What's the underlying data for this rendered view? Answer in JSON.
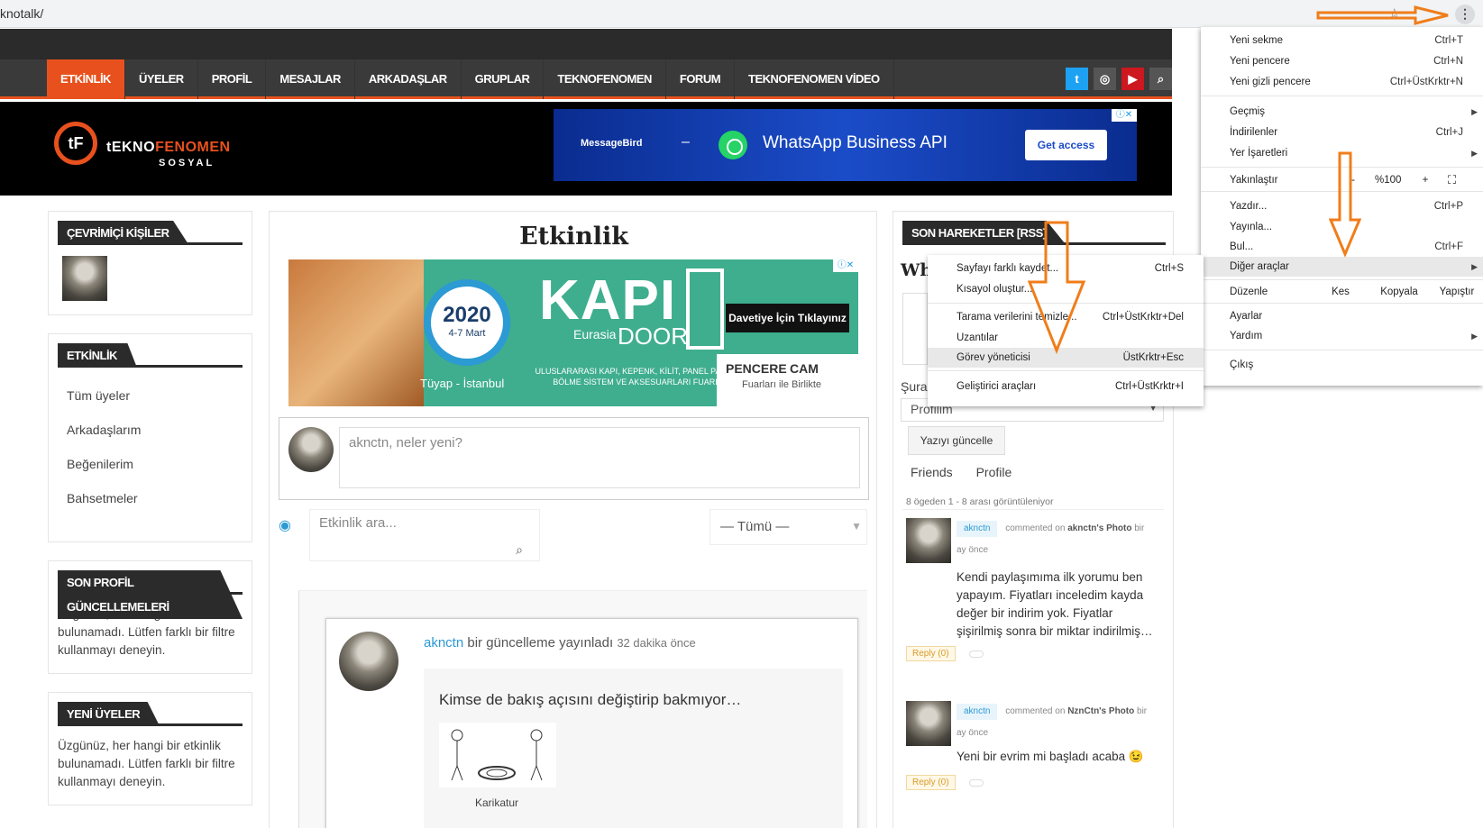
{
  "browser": {
    "url": "knotalk/",
    "star_icon": "star-icon",
    "menu_icon": "kebab-menu-icon"
  },
  "nav": {
    "items": [
      "ETKİNLİK",
      "ÜYELER",
      "PROFİL",
      "MESAJLAR",
      "ARKADAŞLAR",
      "GRUPLAR",
      "TEKNOFENOMEN",
      "FORUM",
      "TEKNOFENOMEN VİDEO"
    ],
    "active_index": 0,
    "social": [
      "twitter-icon",
      "instagram-icon",
      "youtube-icon",
      "search-icon"
    ],
    "accent": "#e8511d"
  },
  "logo": {
    "mark": "tF",
    "name_a": "tEKNO",
    "name_b": "FENOMEN",
    "sub": "SOSYAL"
  },
  "ad_top": {
    "brand": "MessageBird",
    "dash": "–",
    "title": "WhatsApp Business API",
    "button": "Get access"
  },
  "left": {
    "online": {
      "title": "ÇEVRİMİÇİ KİŞİLER"
    },
    "activity": {
      "title": "ETKİNLİK",
      "links": [
        "Tüm üyeler",
        "Arkadaşlarım",
        "Beğenilerim",
        "Bahsetmeler"
      ]
    },
    "profile_updates": {
      "title": "SON PROFİL GÜNCELLEMELERİ",
      "text": "Üzgünüz, her hangi bir etkinlik bulunamadı. Lütfen farklı bir filtre kullanmayı deneyin."
    },
    "new_members": {
      "title": "YENİ ÜYELER",
      "text": "Üzgünüz, her hangi bir etkinlik bulunamadı. Lütfen farklı bir filtre kullanmayı deneyin."
    }
  },
  "main": {
    "title": "Etkinlik",
    "ad": {
      "year": "2020",
      "dates": "4-7 Mart",
      "venue": "Tüyap - İstanbul",
      "kapi": "KAPI",
      "eurasia": "Eurasia",
      "door": "DOOR",
      "desc": "ULUSLARARASI KAPI, KEPENK, KİLİT, PANEL PANO, BÖLME SİSTEM VE AKSESUARLARI FUARI",
      "cta": "Davetiye İçin Tıklayınız",
      "pencere": "PENCERE",
      "cam": "CAM",
      "together": "Fuarları ile Birlikte"
    },
    "post_placeholder": "aknctn, neler yeni?",
    "search_placeholder": "Etkinlik ara...",
    "filter_value": "— Tümü —",
    "activity": {
      "user": "aknctn",
      "action": "bir güncelleme yayınladı",
      "time": "32 dakika önce",
      "text": "Kimse de bakış açısını değiştirip bakmıyor…",
      "caption": "Karikatur"
    }
  },
  "right": {
    "title": "SON HAREKETLER [RSS]",
    "wh": "Wh",
    "sura": "Şura",
    "select_value": "Profilim",
    "update_button": "Yazıyı güncelle",
    "tabs": [
      "Friends",
      "Profile"
    ],
    "count": "8 ögeden 1 - 8 arası görüntüleniyor",
    "comments": [
      {
        "user": "aknctn",
        "action": "commented on",
        "target": "aknctn's Photo",
        "time_a": "bir",
        "time_b": "ay önce",
        "body": "Kendi paylaşımıma ilk yorumu ben yapayım. Fiyatları inceledim kayda değer bir indirim yok. Fiyatlar şişirilmiş sonra bir miktar indirilmiş…",
        "reply": "Reply (0)"
      },
      {
        "user": "aknctn",
        "action": "commented on",
        "target": "NznCtn's Photo",
        "time_a": "bir",
        "time_b": "ay önce",
        "body": "Yeni bir evrim mi başladı acaba 😉",
        "reply": "Reply (0)"
      }
    ]
  },
  "chrome_menu": {
    "new_tab": "Yeni sekme",
    "new_tab_sc": "Ctrl+T",
    "new_window": "Yeni pencere",
    "new_window_sc": "Ctrl+N",
    "incognito": "Yeni gizli pencere",
    "incognito_sc": "Ctrl+ÜstKrktr+N",
    "history": "Geçmiş",
    "downloads": "İndirilenler",
    "downloads_sc": "Ctrl+J",
    "bookmarks": "Yer İşaretleri",
    "zoom": "Yakınlaştır",
    "zoom_minus": "-",
    "zoom_value": "%100",
    "zoom_plus": "+",
    "print": "Yazdır...",
    "print_sc": "Ctrl+P",
    "cast": "Yayınla...",
    "find": "Bul...",
    "find_sc": "Ctrl+F",
    "more_tools": "Diğer araçlar",
    "edit": "Düzenle",
    "cut": "Kes",
    "copy": "Kopyala",
    "paste": "Yapıştır",
    "settings": "Ayarlar",
    "help": "Yardım",
    "exit": "Çıkış"
  },
  "submenu": {
    "save_as": "Sayfayı farklı kaydet...",
    "save_as_sc": "Ctrl+S",
    "shortcut": "Kısayol oluştur...",
    "clear": "Tarama verilerini temizle...",
    "clear_sc": "Ctrl+ÜstKrktr+Del",
    "extensions": "Uzantılar",
    "task_manager": "Görev yöneticisi",
    "task_manager_sc": "ÜstKrktr+Esc",
    "devtools": "Geliştirici araçları",
    "devtools_sc": "Ctrl+ÜstKrktr+I"
  }
}
